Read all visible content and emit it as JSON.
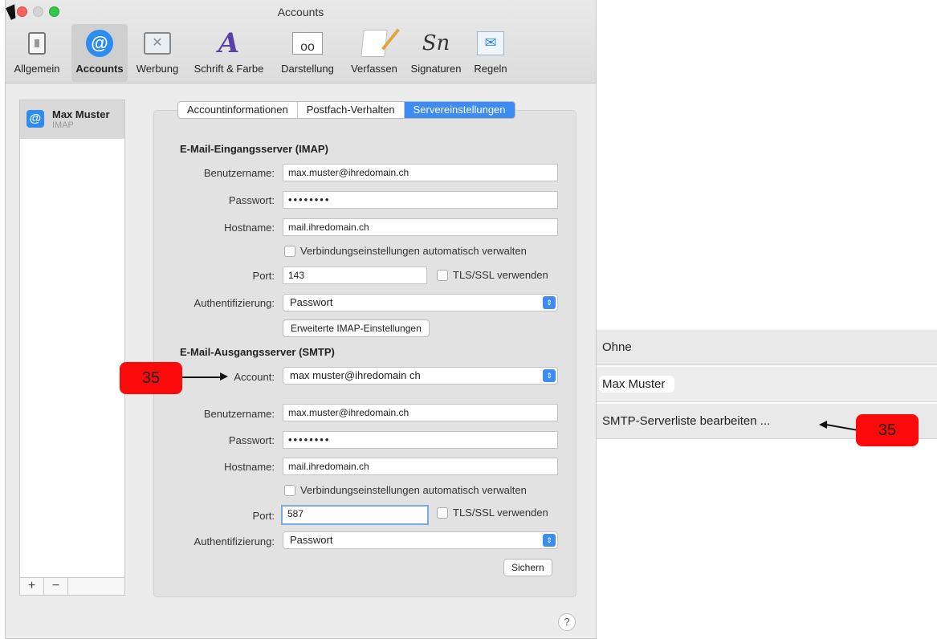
{
  "window": {
    "title": "Accounts"
  },
  "toolbar": {
    "items": [
      {
        "label": "Allgemein",
        "icon": "switch-icon"
      },
      {
        "label": "Accounts",
        "icon": "at-icon"
      },
      {
        "label": "Werbung",
        "icon": "junk-icon"
      },
      {
        "label": "Schrift & Farbe",
        "icon": "font-icon"
      },
      {
        "label": "Darstellung",
        "icon": "glasses-icon"
      },
      {
        "label": "Verfassen",
        "icon": "compose-icon"
      },
      {
        "label": "Signaturen",
        "icon": "signature-icon"
      },
      {
        "label": "Regeln",
        "icon": "rules-icon"
      }
    ]
  },
  "sidebar": {
    "account": {
      "name": "Max Muster",
      "type": "IMAP"
    },
    "add_label": "+",
    "remove_label": "−"
  },
  "tabs": [
    "Accountinformationen",
    "Postfach-Verhalten",
    "Servereinstellungen"
  ],
  "imap": {
    "title": "E-Mail-Eingangsserver (IMAP)",
    "username_label": "Benutzername:",
    "username": "max.muster@ihredomain.ch",
    "password_label": "Passwort:",
    "password": "••••••••",
    "hostname_label": "Hostname:",
    "hostname": "mail.ihredomain.ch",
    "auto_label": "Verbindungseinstellungen automatisch verwalten",
    "port_label": "Port:",
    "port": "143",
    "tls_label": "TLS/SSL verwenden",
    "auth_label": "Authentifizierung:",
    "auth": "Passwort",
    "advanced_button": "Erweiterte IMAP-Einstellungen"
  },
  "smtp": {
    "title": "E-Mail-Ausgangsserver (SMTP)",
    "account_label": "Account:",
    "account": "max muster@ihredomain ch",
    "username_label": "Benutzername:",
    "username": "max.muster@ihredomain.ch",
    "password_label": "Passwort:",
    "password": "••••••••",
    "hostname_label": "Hostname:",
    "hostname": "mail.ihredomain.ch",
    "auto_label": "Verbindungseinstellungen automatisch verwalten",
    "port_label": "Port:",
    "port": "587",
    "tls_label": "TLS/SSL verwenden",
    "auth_label": "Authentifizierung:",
    "auth": "Passwort",
    "save_button": "Sichern"
  },
  "help_label": "?",
  "markers": {
    "left": "35",
    "right": "35"
  },
  "popup": {
    "items": [
      "Ohne",
      "Max Muster",
      "SMTP-Serverliste bearbeiten ..."
    ]
  }
}
